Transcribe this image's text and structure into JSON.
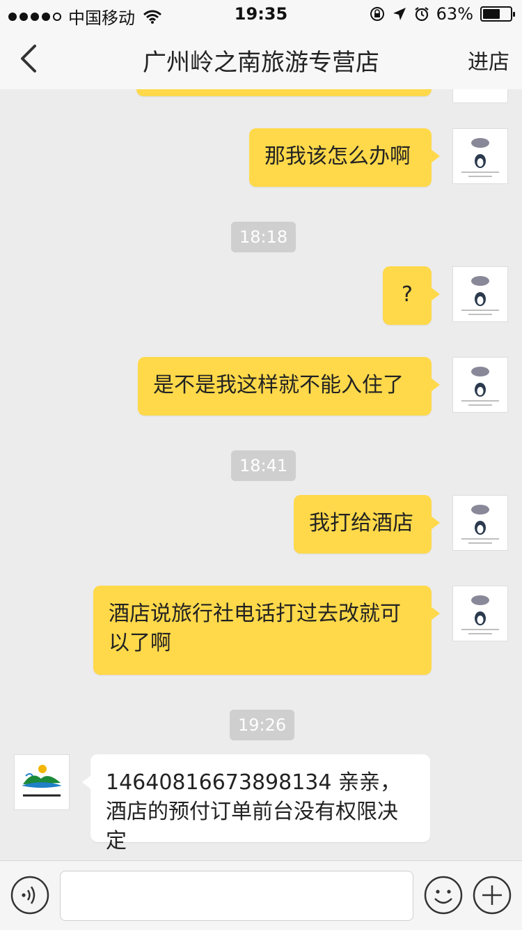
{
  "status_bar": {
    "carrier": "中国移动",
    "time": "19:35",
    "battery_percent": "63%",
    "battery_level": 0.63,
    "icons": [
      "signal-dots",
      "wifi-icon",
      "lock-rotation-icon",
      "location-arrow-icon",
      "alarm-icon",
      "battery-icon"
    ]
  },
  "nav": {
    "back_icon": "chevron-left-icon",
    "title": "广州岭之南旅游专营店",
    "enter_store": "进店"
  },
  "chat": {
    "timestamps": [
      "18:18",
      "18:41",
      "19:26"
    ],
    "messages": [
      {
        "from": "me",
        "text": "那我该怎么办啊"
      },
      {
        "from": "me",
        "text": "?"
      },
      {
        "from": "me",
        "text": "是不是我这样就不能入住了"
      },
      {
        "from": "me",
        "text": "我打给酒店"
      },
      {
        "from": "me",
        "text": "酒店说旅行社电话打过去改就可以了啊"
      },
      {
        "from": "store",
        "text": "14640816673898134  亲亲，酒店的预付订单前台没有权限决定"
      }
    ],
    "colors": {
      "outgoing": "#ffd94a",
      "incoming": "#ffffff",
      "background": "#ececec"
    }
  },
  "input_bar": {
    "voice_icon": "voice-icon",
    "input_value": "",
    "emoji_icon": "emoji-icon",
    "plus_icon": "plus-icon"
  }
}
